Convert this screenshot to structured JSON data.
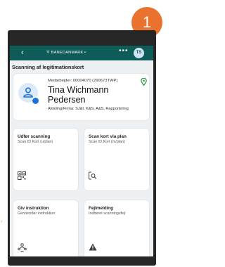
{
  "step_badge": "1",
  "appbar": {
    "back_glyph": "‹",
    "brand": "⛛ BANEDANMARK",
    "menu_glyph": "⌄",
    "more_glyph": "•••",
    "user_initials": "TS",
    "color": "#0d5c58"
  },
  "page_title": "Scanning af legitimationskort",
  "employee": {
    "id_line": "Medarbejder: 00004070 (290673TWP)",
    "name": "Tina Wichmann Pedersen",
    "dept": "Afdeling/Firma: SJ&I, K&S, A&S, Rapportering"
  },
  "tiles": [
    {
      "title": "Udfør scanning",
      "subtitle": "Scan ID Kort (u/plan)",
      "icon": "qr-code-icon"
    },
    {
      "title": "Scan kort via plan",
      "subtitle": "Scan ID Kort (m/plan)",
      "icon": "scan-search-icon"
    },
    {
      "title": "Giv instruktion",
      "subtitle": "Gennemfør instruktion",
      "icon": "instruction-icon"
    },
    {
      "title": "Fejlmelding",
      "subtitle": "Indberet scanningsfejl",
      "icon": "warning-icon"
    }
  ],
  "accent_color": "#e9722f"
}
